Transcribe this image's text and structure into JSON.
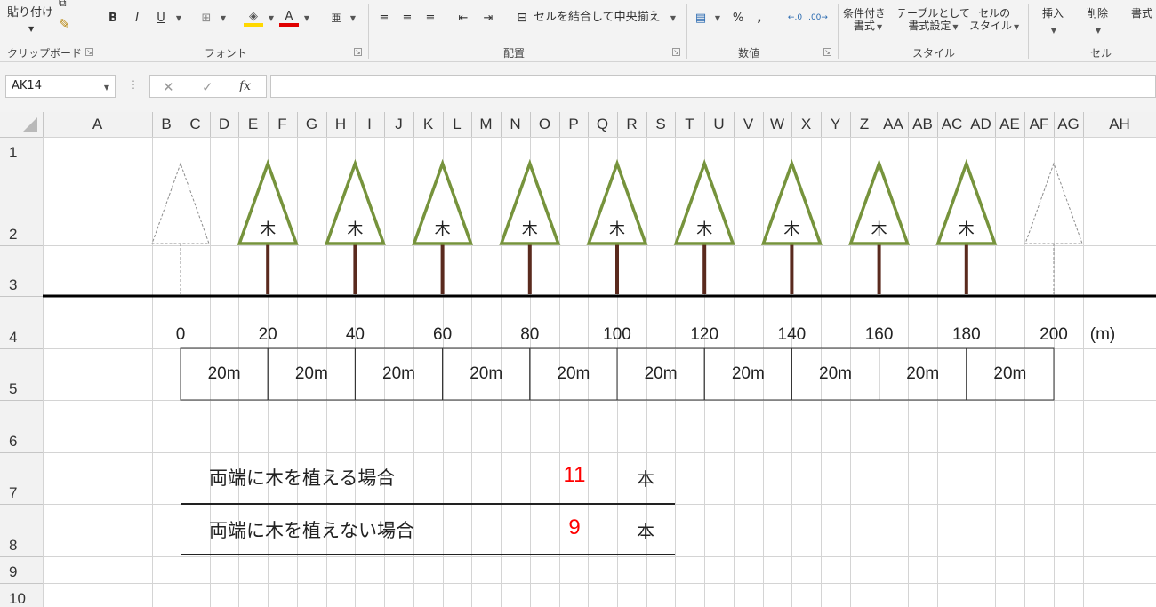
{
  "ribbon": {
    "clipboard": {
      "paste": "貼り付け",
      "label": "クリップボード"
    },
    "font": {
      "bold": "B",
      "italic": "I",
      "underline": "U",
      "font_color": "A",
      "label": "フォント"
    },
    "alignment": {
      "merge_center": "セルを結合して中央揃え",
      "label": "配置"
    },
    "number": {
      "percent": "%",
      "comma": ",",
      "label": "数値"
    },
    "styles": {
      "conditional_line1": "条件付き",
      "conditional_line2": "書式",
      "table_line1": "テーブルとして",
      "table_line2": "書式設定",
      "cell_style_line1": "セルの",
      "cell_style_line2": "スタイル",
      "label": "スタイル"
    },
    "cells": {
      "insert": "挿入",
      "delete": "削除",
      "format": "書式",
      "label": "セル"
    }
  },
  "formula_bar": {
    "name_box": "AK14",
    "formula": ""
  },
  "columns": [
    "A",
    "B",
    "C",
    "D",
    "E",
    "F",
    "G",
    "H",
    "I",
    "J",
    "K",
    "L",
    "M",
    "N",
    "O",
    "P",
    "Q",
    "R",
    "S",
    "T",
    "U",
    "V",
    "W",
    "X",
    "Y",
    "Z",
    "AA",
    "AB",
    "AC",
    "AD",
    "AE",
    "AF",
    "AG",
    "AH"
  ],
  "rows": [
    "1",
    "2",
    "3",
    "4",
    "5",
    "6",
    "7",
    "8",
    "9",
    "10"
  ],
  "diagram": {
    "tree_char": "木",
    "axis_labels": [
      "0",
      "20",
      "40",
      "60",
      "80",
      "100",
      "120",
      "140",
      "160",
      "180",
      "200"
    ],
    "axis_unit": "(m)",
    "segment_label": "20m",
    "segment_count": 10,
    "colors": {
      "tree_outline": "#76933c",
      "trunk": "#5a2a1e",
      "ghost": "#8c8c8c",
      "ground": "#000000",
      "value": "#ff0000"
    }
  },
  "cases": [
    {
      "label": "両端に木を植える場合",
      "value": "11",
      "unit": "本"
    },
    {
      "label": "両端に木を植えない場合",
      "value": "9",
      "unit": "本"
    }
  ]
}
